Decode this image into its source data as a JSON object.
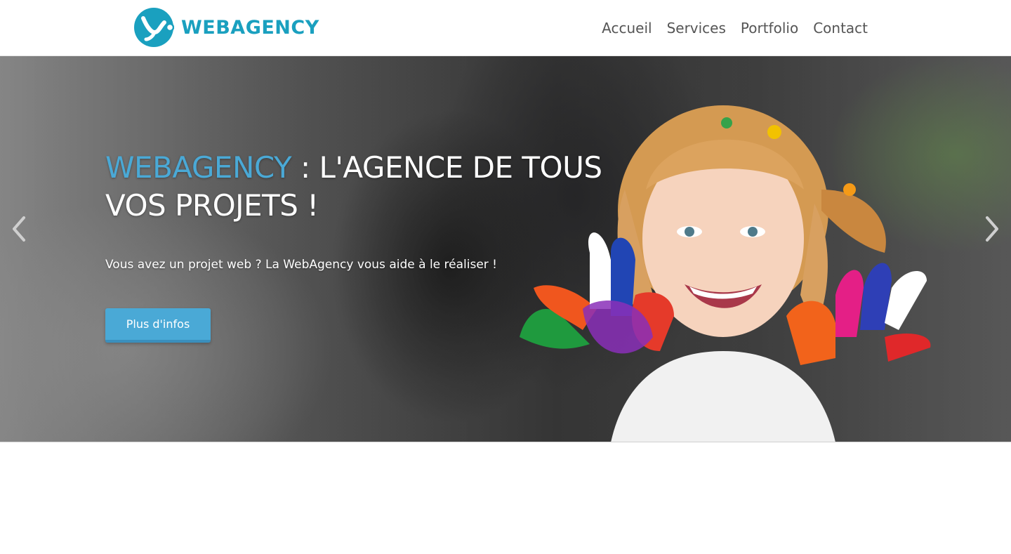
{
  "header": {
    "brand": "WEBAGENCY",
    "nav": [
      {
        "label": "Accueil"
      },
      {
        "label": "Services"
      },
      {
        "label": "Portfolio"
      },
      {
        "label": "Contact"
      }
    ]
  },
  "hero": {
    "title_brand": "WEBAGENCY",
    "title_rest": " : L'AGENCE DE TOUS VOS PROJETS !",
    "subtitle": "Vous avez un projet web ? La WebAgency vous aide à le réaliser !",
    "button_label": "Plus d'infos",
    "prev_icon": "chevron-left-icon",
    "next_icon": "chevron-right-icon"
  },
  "colors": {
    "brand": "#1aa0bf",
    "accent": "#4aa9d6",
    "nav_text": "#555555"
  }
}
